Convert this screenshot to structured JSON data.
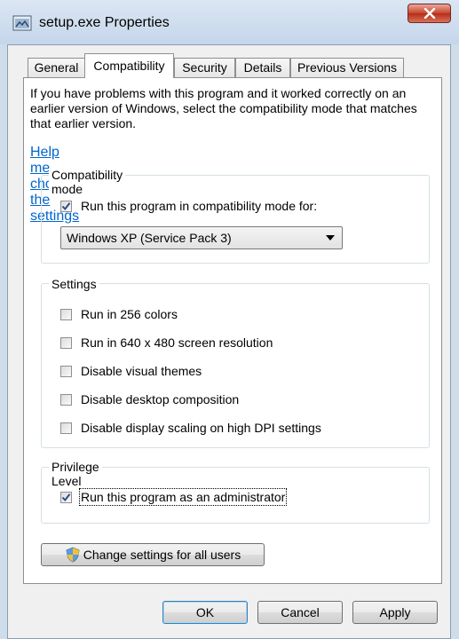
{
  "window": {
    "title": "setup.exe Properties"
  },
  "tabs": [
    {
      "label": "General",
      "active": false
    },
    {
      "label": "Compatibility",
      "active": true
    },
    {
      "label": "Security",
      "active": false
    },
    {
      "label": "Details",
      "active": false
    },
    {
      "label": "Previous Versions",
      "active": false
    }
  ],
  "compat": {
    "intro": "If you have problems with this program and it worked correctly on an earlier version of Windows, select the compatibility mode that matches that earlier version.",
    "help_link": "Help me choose the settings",
    "mode_group": "Compatibility mode",
    "mode_checkbox": {
      "label": "Run this program in compatibility mode for:",
      "checked": true
    },
    "mode_selected": "Windows XP (Service Pack 3)",
    "settings_group": "Settings",
    "settings": [
      {
        "label": "Run in 256 colors",
        "checked": false
      },
      {
        "label": "Run in 640 x 480 screen resolution",
        "checked": false
      },
      {
        "label": "Disable visual themes",
        "checked": false
      },
      {
        "label": "Disable desktop composition",
        "checked": false
      },
      {
        "label": "Disable display scaling on high DPI settings",
        "checked": false
      }
    ],
    "privilege_group": "Privilege Level",
    "admin_checkbox": {
      "label": "Run this program as an administrator",
      "checked": true
    },
    "change_all_button": "Change settings for all users"
  },
  "footer": {
    "ok": "OK",
    "cancel": "Cancel",
    "apply": "Apply"
  },
  "icons": {
    "title": "application-icon",
    "close": "close-icon",
    "shield": "uac-shield-icon",
    "dropdown": "chevron-down-icon",
    "check": "checkmark-icon"
  },
  "colors": {
    "link": "#0066cc",
    "close_button": "#c8442c",
    "titlebar": "#c5d6ea"
  }
}
